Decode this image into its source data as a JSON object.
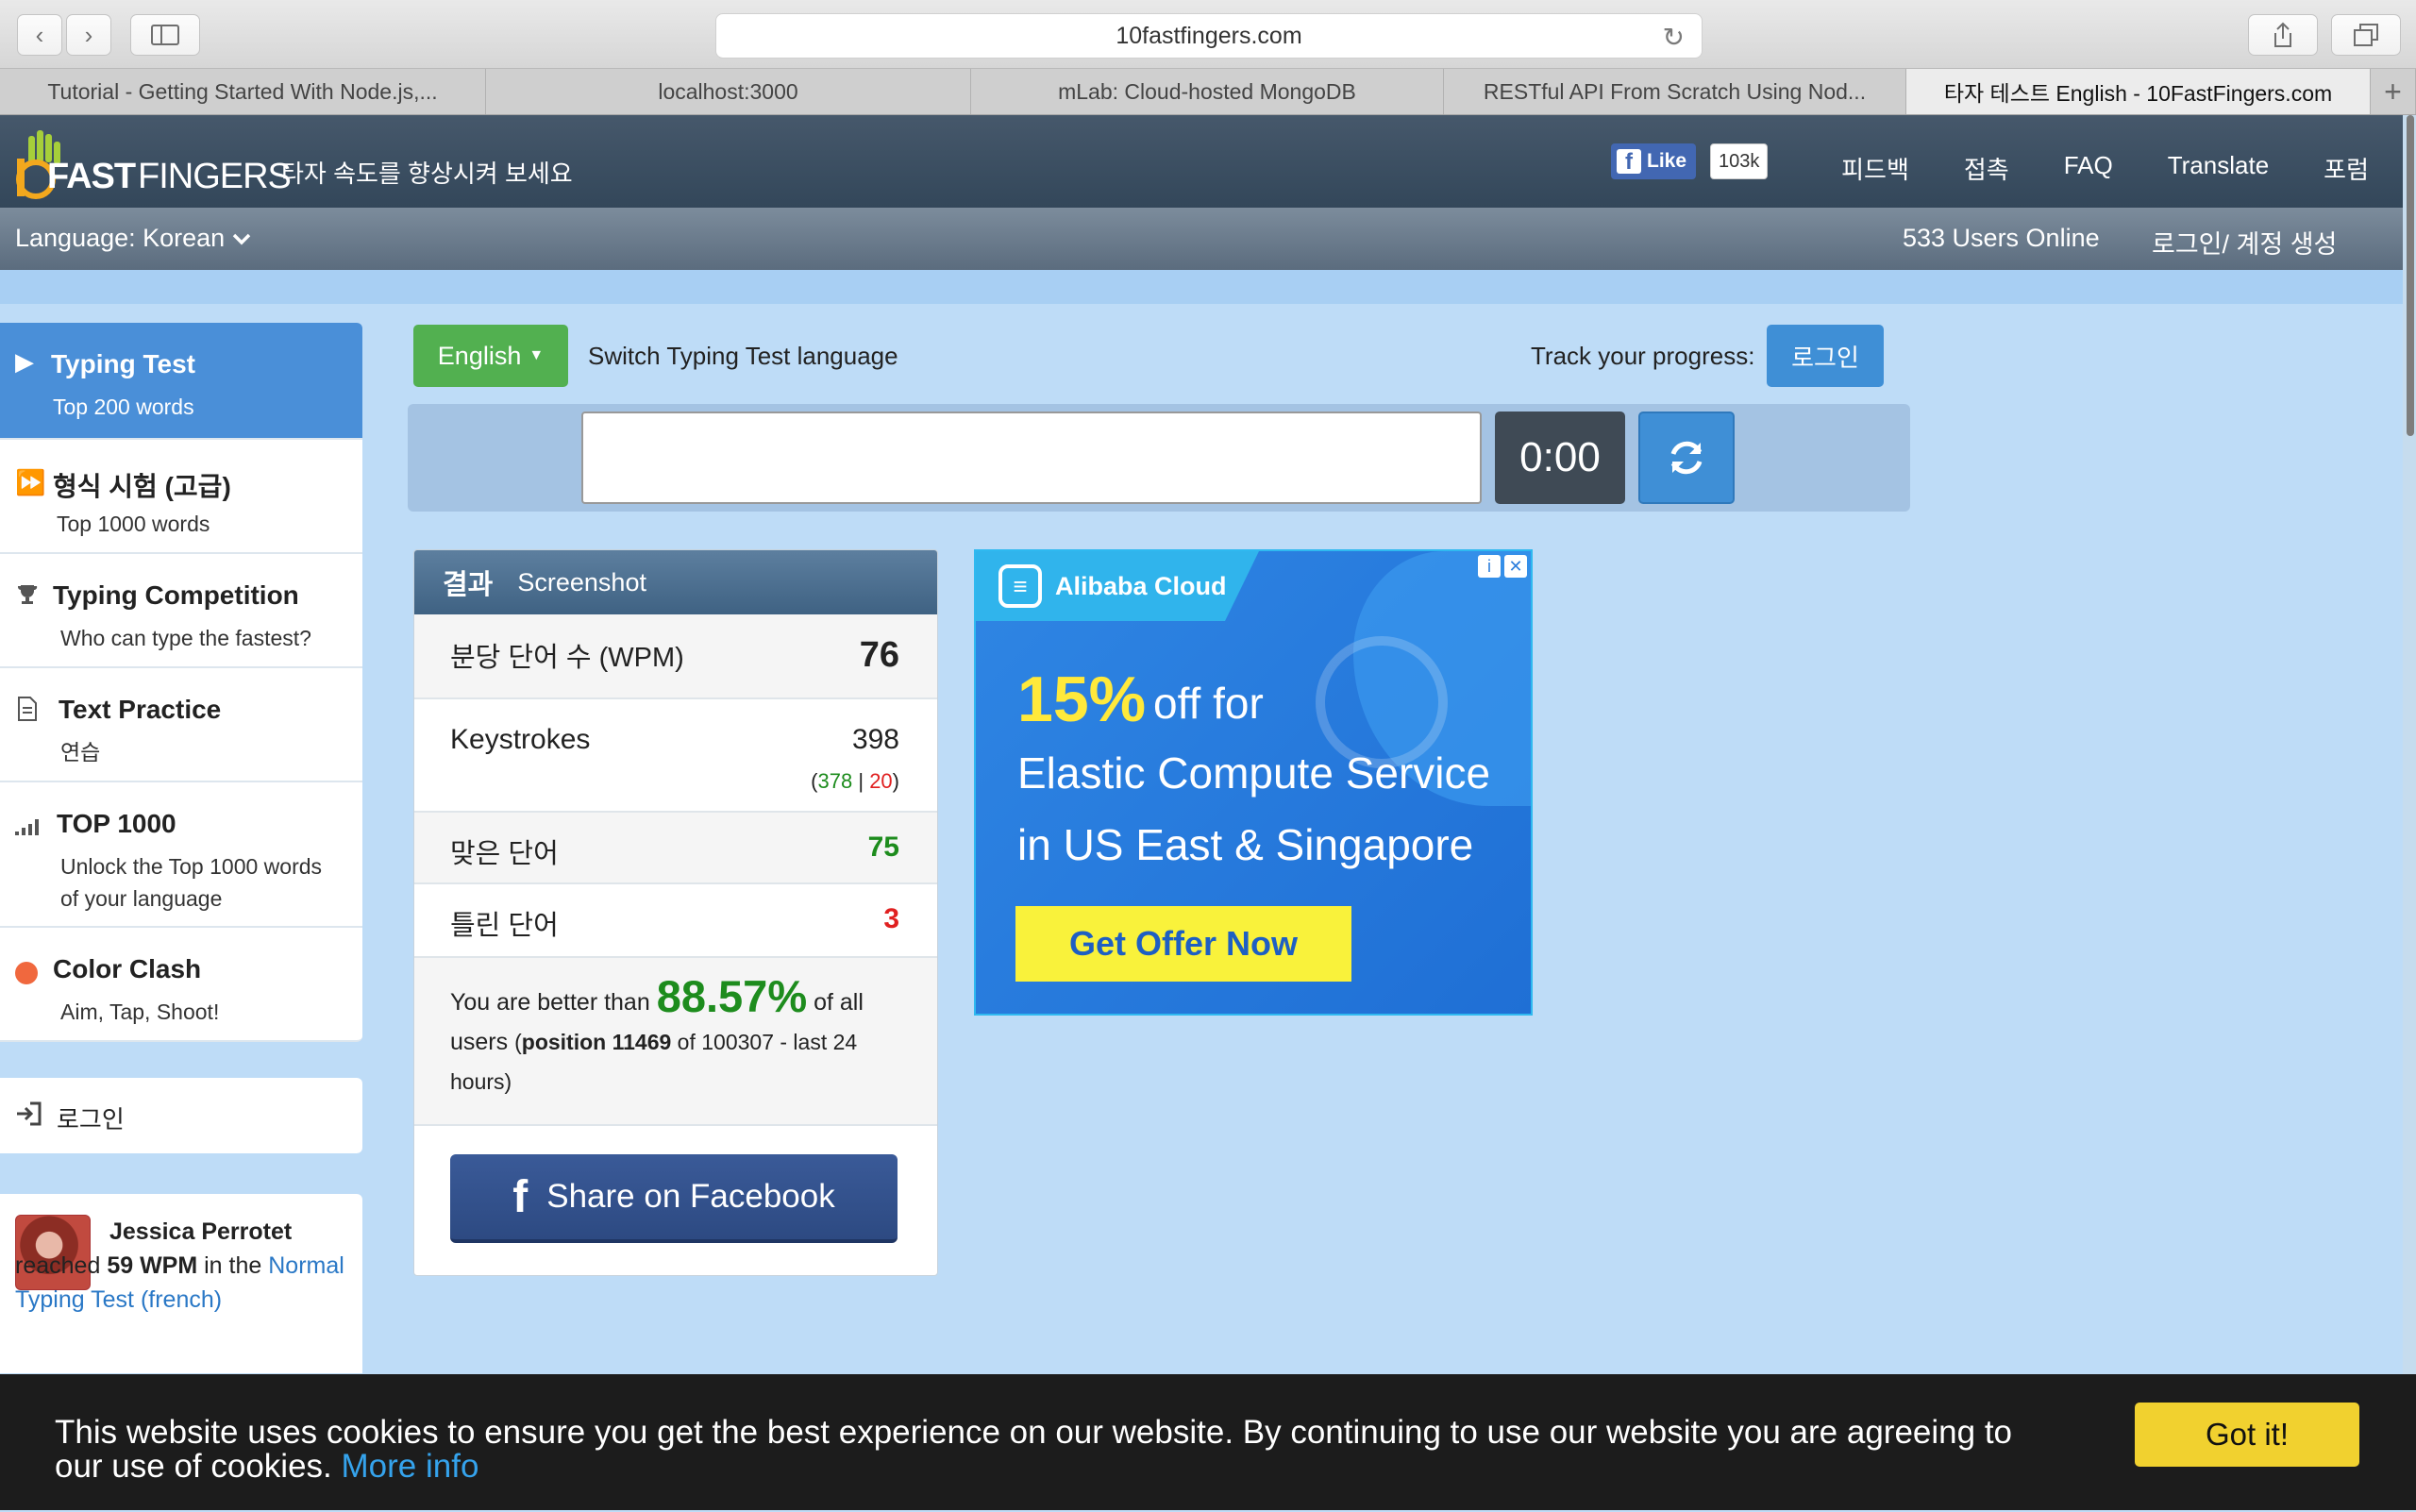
{
  "browser": {
    "url": "10fastfingers.com",
    "tabs": [
      {
        "label": "Tutorial - Getting Started With Node.js,..."
      },
      {
        "label": "localhost:3000"
      },
      {
        "label": "mLab: Cloud-hosted MongoDB"
      },
      {
        "label": "RESTful API From Scratch Using Nod..."
      },
      {
        "label": "타자 테스트 English - 10FastFingers.com"
      }
    ],
    "active_tab": 4
  },
  "header": {
    "logo_fast": "FAST",
    "logo_fingers": "FINGERS",
    "tagline": "타자 속도를 향상시켜 보세요",
    "fb_like": "Like",
    "fb_count": "103k",
    "nav": [
      "피드백",
      "접촉",
      "FAQ",
      "Translate",
      "포럼"
    ]
  },
  "langbar": {
    "language": "Language: Korean",
    "users_online": "533 Users Online",
    "login": "로그인/ 계정 생성"
  },
  "sidebar": {
    "items": [
      {
        "title": "Typing Test",
        "sub": "Top 200 words",
        "icon": "play-icon"
      },
      {
        "title": "형식 시험 (고급)",
        "sub": "Top 1000 words",
        "icon": "fast-forward-icon"
      },
      {
        "title": "Typing Competition",
        "sub": "Who can type the fastest?",
        "icon": "trophy-icon"
      },
      {
        "title": "Text Practice",
        "sub": "연습",
        "icon": "document-icon"
      },
      {
        "title": "TOP 1000",
        "sub": "Unlock the Top 1000 words of your language",
        "icon": "signal-bars-icon"
      },
      {
        "title": "Color Clash",
        "sub": "Aim, Tap, Shoot!",
        "icon": "color-dot-icon"
      }
    ],
    "login": "로그인",
    "activity": {
      "name": "Jessica Perrotet",
      "reached": "reached",
      "wpm": "59 WPM",
      "in_the": "in the",
      "link": "Normal Typing Test (french)"
    }
  },
  "typing": {
    "language_button": "English",
    "switch_label": "Switch Typing Test language",
    "track_label": "Track your progress:",
    "track_login": "로그인",
    "input_value": "",
    "timer": "0:00"
  },
  "result": {
    "tab_result": "결과",
    "tab_screenshot": "Screenshot",
    "wpm_label": "분당 단어 수 (WPM)",
    "wpm_value": "76",
    "keys_label": "Keystrokes",
    "keys_value": "398",
    "keys_correct": "378",
    "keys_sep": "|",
    "keys_wrong": "20",
    "correct_label": "맞은 단어",
    "correct_value": "75",
    "wrong_label": "틀린 단어",
    "wrong_value": "3",
    "better_prefix": "You are better than",
    "better_pct": "88.57%",
    "better_of": "of",
    "better_all": "all users",
    "position": "position 11469",
    "position_rest": "of 100307 - last 24 hours",
    "share": "Share on Facebook"
  },
  "ad": {
    "brand": "Alibaba Cloud",
    "pct": "15%",
    "pct_text": "off for",
    "line1": "Elastic Compute Service",
    "line2": "in US East & Singapore",
    "cta": "Get Offer Now"
  },
  "cookie": {
    "text": "This website uses cookies to ensure you get the best experience on our website. By continuing to use our website you are agreeing to our use of cookies.",
    "more": "More info",
    "button": "Got it!"
  },
  "colors": {
    "accent_blue": "#3f8fd6",
    "green": "#52b050",
    "header": "#3a4d61",
    "page_bg": "#bedcf7"
  }
}
